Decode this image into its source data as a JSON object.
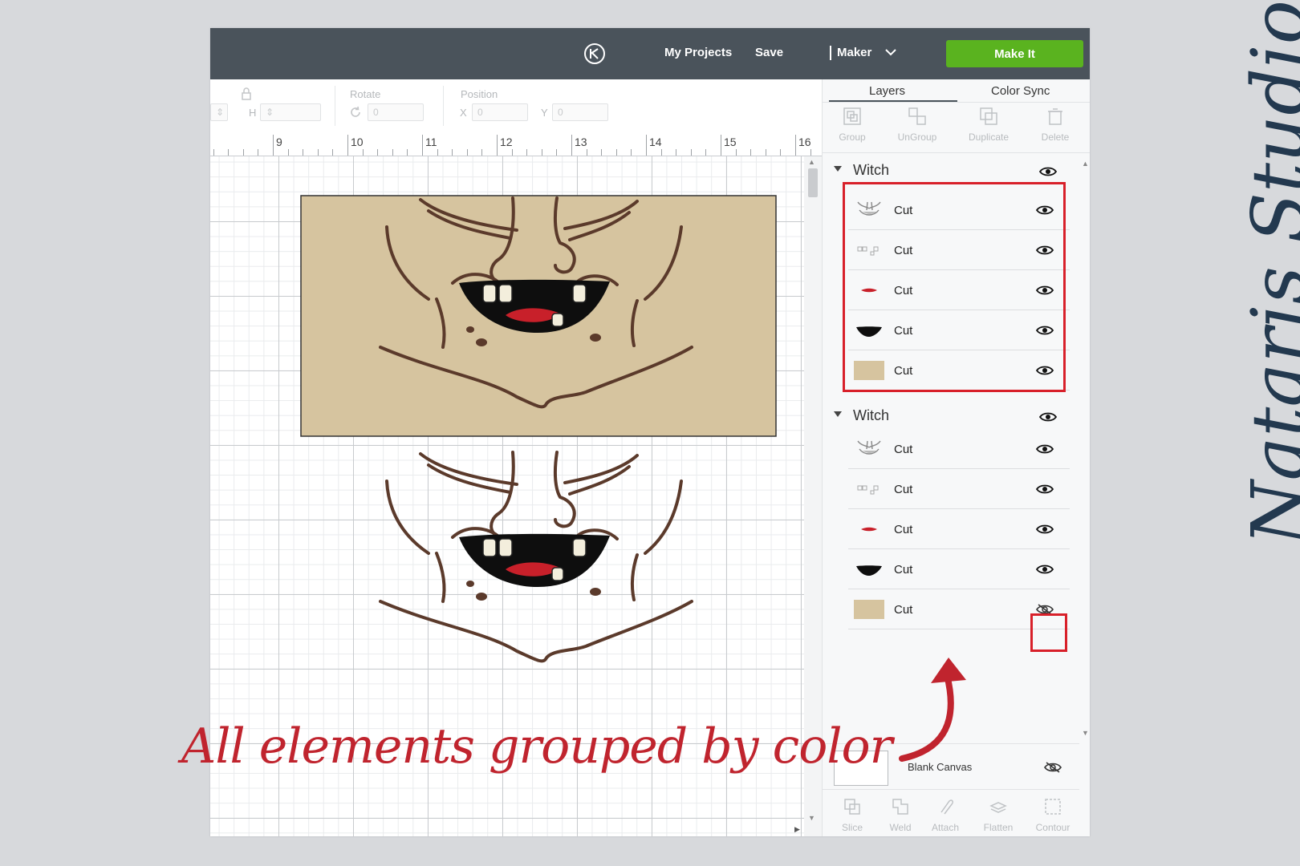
{
  "header": {
    "my_projects": "My Projects",
    "save": "Save",
    "machine": "Maker",
    "make_it": "Make It"
  },
  "toolbar": {
    "size_h": "H",
    "rotate_label": "Rotate",
    "rotate_value": "0",
    "position_label": "Position",
    "pos_x_letter": "X",
    "pos_x_value": "0",
    "pos_y_letter": "Y",
    "pos_y_value": "0"
  },
  "ruler": {
    "numbers": [
      "9",
      "10",
      "11",
      "12",
      "13",
      "14",
      "15",
      "16"
    ]
  },
  "panel": {
    "tabs": [
      "Layers",
      "Color Sync"
    ],
    "actions": [
      "Group",
      "UnGroup",
      "Duplicate",
      "Delete"
    ],
    "groups": [
      {
        "name": "Witch",
        "layers": [
          {
            "label": "Cut",
            "thumb": "face-lines",
            "visible": true
          },
          {
            "label": "Cut",
            "thumb": "teeth",
            "visible": true
          },
          {
            "label": "Cut",
            "thumb": "tongue",
            "visible": true
          },
          {
            "label": "Cut",
            "thumb": "mouth",
            "visible": true
          },
          {
            "label": "Cut",
            "thumb": "skin",
            "visible": true
          }
        ]
      },
      {
        "name": "Witch",
        "layers": [
          {
            "label": "Cut",
            "thumb": "face-lines",
            "visible": true
          },
          {
            "label": "Cut",
            "thumb": "teeth",
            "visible": true
          },
          {
            "label": "Cut",
            "thumb": "tongue",
            "visible": true
          },
          {
            "label": "Cut",
            "thumb": "mouth",
            "visible": true
          },
          {
            "label": "Cut",
            "thumb": "skin",
            "visible": false
          }
        ]
      }
    ],
    "blank_canvas": "Blank Canvas",
    "bottom_actions": [
      "Slice",
      "Weld",
      "Attach",
      "Flatten",
      "Contour"
    ]
  },
  "annotation": "All elements grouped by color",
  "signature": "Nataris Studio",
  "colors": {
    "header_bg": "#4a535b",
    "make_it": "#5ab31f",
    "skin": "#d6c49f",
    "line": "#5b3a2b",
    "highlight": "#d8202a",
    "annotation": "#c0242e",
    "signature": "#23394f"
  }
}
